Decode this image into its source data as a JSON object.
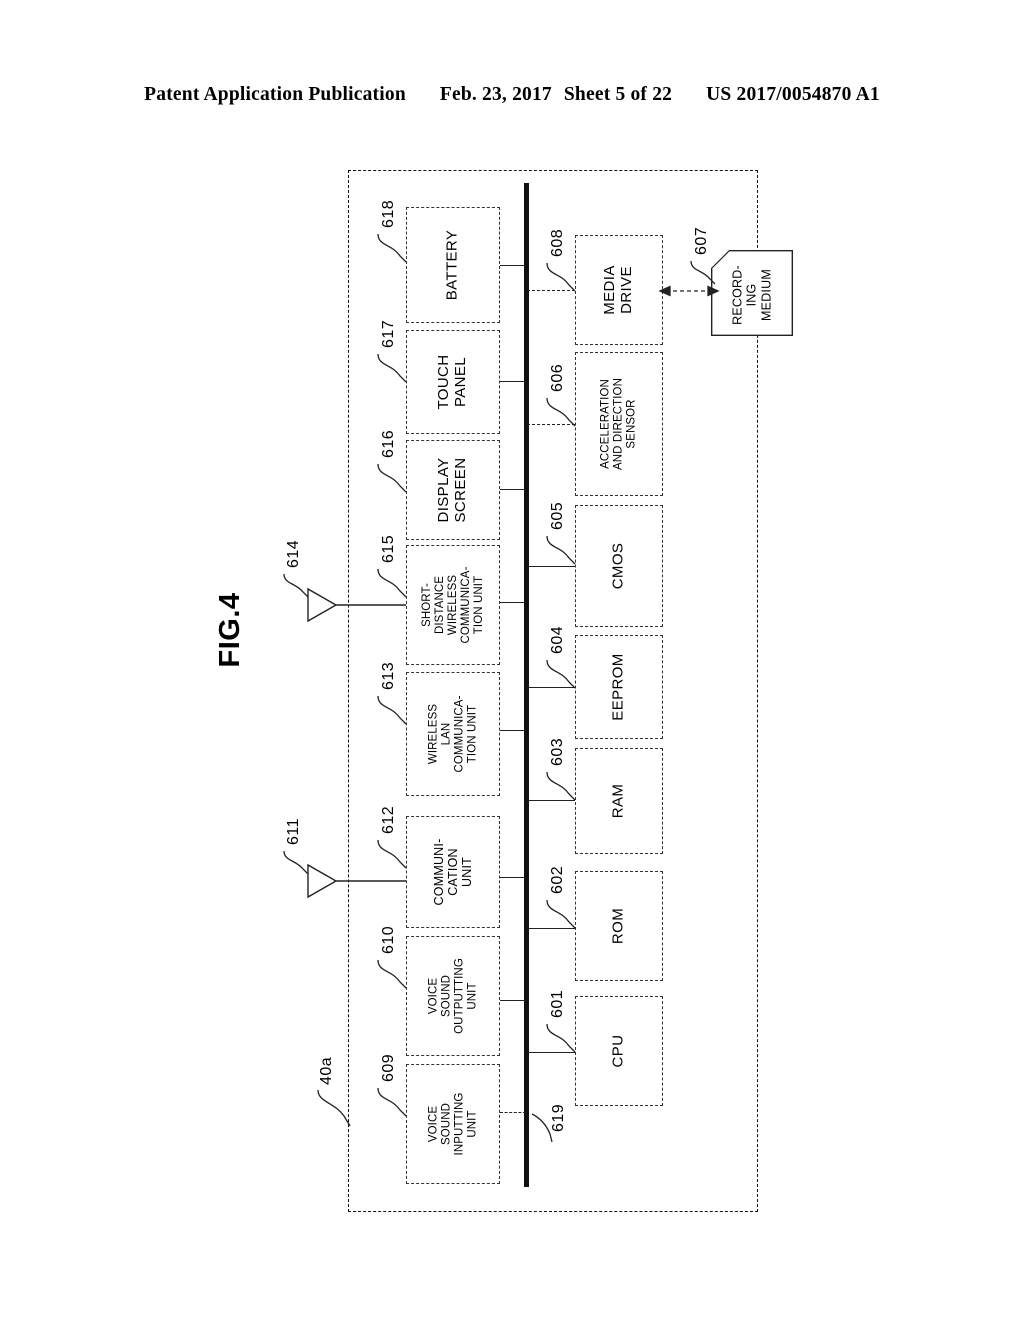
{
  "header": {
    "publication": "Patent Application Publication",
    "date": "Feb. 23, 2017",
    "sheet": "Sheet 5 of 22",
    "doc_number": "US 2017/0054870 A1"
  },
  "figure": {
    "title": "FIG.4",
    "device_ref": "40a",
    "bus_ref": "619"
  },
  "blocks": {
    "battery": {
      "ref": "618",
      "label": "BATTERY"
    },
    "touch_panel": {
      "ref": "617",
      "label": "TOUCH\nPANEL"
    },
    "display_screen": {
      "ref": "616",
      "label": "DISPLAY\nSCREEN"
    },
    "short_distance": {
      "ref": "615",
      "label": "SHORT-\nDISTANCE\nWIRELESS\nCOMMUNICA-\nTION UNIT"
    },
    "wireless_lan": {
      "ref": "613",
      "label": "WIRELESS\nLAN\nCOMMUNICA-\nTION UNIT"
    },
    "communication_unit": {
      "ref": "612",
      "label": "COMMUNI-\nCATION\nUNIT"
    },
    "voice_out": {
      "ref": "610",
      "label": "VOICE\nSOUND\nOUTPUTTING\nUNIT"
    },
    "voice_in": {
      "ref": "609",
      "label": "VOICE\nSOUND\nINPUTTING\nUNIT"
    },
    "media_drive": {
      "ref": "608",
      "label": "MEDIA\nDRIVE"
    },
    "recording_medium": {
      "ref": "607",
      "label": "RECORD-\nING\nMEDIUM"
    },
    "accel_sensor": {
      "ref": "606",
      "label": "ACCELERATION\nAND DIRECTION\nSENSOR"
    },
    "cmos": {
      "ref": "605",
      "label": "CMOS"
    },
    "eeprom": {
      "ref": "604",
      "label": "EEPROM"
    },
    "ram": {
      "ref": "603",
      "label": "RAM"
    },
    "rom": {
      "ref": "602",
      "label": "ROM"
    },
    "cpu": {
      "ref": "601",
      "label": "CPU"
    }
  },
  "antennas": {
    "short_distance_antenna": {
      "ref": "614"
    },
    "communication_antenna": {
      "ref": "611"
    }
  }
}
